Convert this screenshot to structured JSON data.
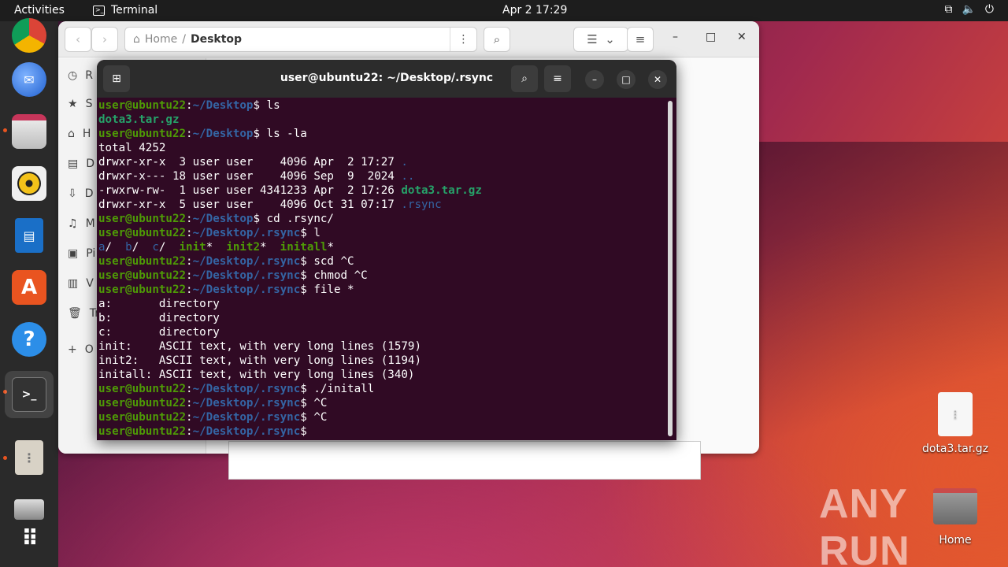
{
  "topbar": {
    "activities": "Activities",
    "app_name": "Terminal",
    "clock": "Apr 2  17:29",
    "tray_icons": [
      "network-icon",
      "volume-icon",
      "power-icon"
    ]
  },
  "dock": {
    "items": [
      "chrome",
      "thunderbird",
      "files",
      "rhythmbox",
      "libreoffice-writer",
      "app-center",
      "help",
      "terminal",
      "archive",
      "disk",
      "show-apps"
    ]
  },
  "files_window": {
    "path_home": "Home",
    "path_separator": "/",
    "path_current": "Desktop",
    "sidebar": [
      {
        "icon": "clock-icon",
        "label": "R"
      },
      {
        "icon": "star-icon",
        "label": "S"
      },
      {
        "icon": "home-icon",
        "label": "H"
      },
      {
        "icon": "document-icon",
        "label": "D"
      },
      {
        "icon": "download-icon",
        "label": "D"
      },
      {
        "icon": "music-icon",
        "label": "M"
      },
      {
        "icon": "picture-icon",
        "label": "Pi"
      },
      {
        "icon": "video-icon",
        "label": "V"
      },
      {
        "icon": "trash-icon",
        "label": "Tr"
      },
      {
        "icon": "plus-icon",
        "label": "O"
      }
    ]
  },
  "terminal": {
    "title": "user@ubuntu22: ~/Desktop/.rsync",
    "prompt_user": "user@ubuntu22",
    "path_desktop": "~/Desktop",
    "path_rsync": "~/Desktop/.rsync",
    "lines": {
      "l1_cmd": " ls",
      "l2_out": "dota3.tar.gz",
      "l3_cmd": " ls -la",
      "l4_out": "total 4252",
      "l5a": "drwxr-xr-x  3 user user    4096 Apr  2 17:27 ",
      "l5b": ".",
      "l6a": "drwxr-x--- 18 user user    4096 Sep  9  2024 ",
      "l6b": "..",
      "l7a": "-rwxrw-rw-  1 user user 4341233 Apr  2 17:26 ",
      "l7b": "dota3.tar.gz",
      "l8a": "drwxr-xr-x  5 user user    4096 Oct 31 07:17 ",
      "l8b": ".rsync",
      "l9_cmd": " cd .rsync/",
      "l10_cmd": " l",
      "l11_a": "a",
      "l11_b": "b",
      "l11_c": "c",
      "l11_init": "init",
      "l11_init2": "init2",
      "l11_initall": "initall",
      "l12_cmd": " scd ^C",
      "l13_cmd": " chmod ^C",
      "l14_cmd": " file *",
      "l15": "a:       directory",
      "l16": "b:       directory",
      "l17": "c:       directory",
      "l18": "init:    ASCII text, with very long lines (1579)",
      "l19": "init2:   ASCII text, with very long lines (1194)",
      "l20": "initall: ASCII text, with very long lines (340)",
      "l21_cmd": " ./initall",
      "l22_cmd": " ^C",
      "l23_cmd": " ^C",
      "l24_cmd": " "
    }
  },
  "desktop": {
    "file_label": "dota3.tar.gz",
    "home_label": "Home",
    "watermark": "ANY RUN"
  }
}
